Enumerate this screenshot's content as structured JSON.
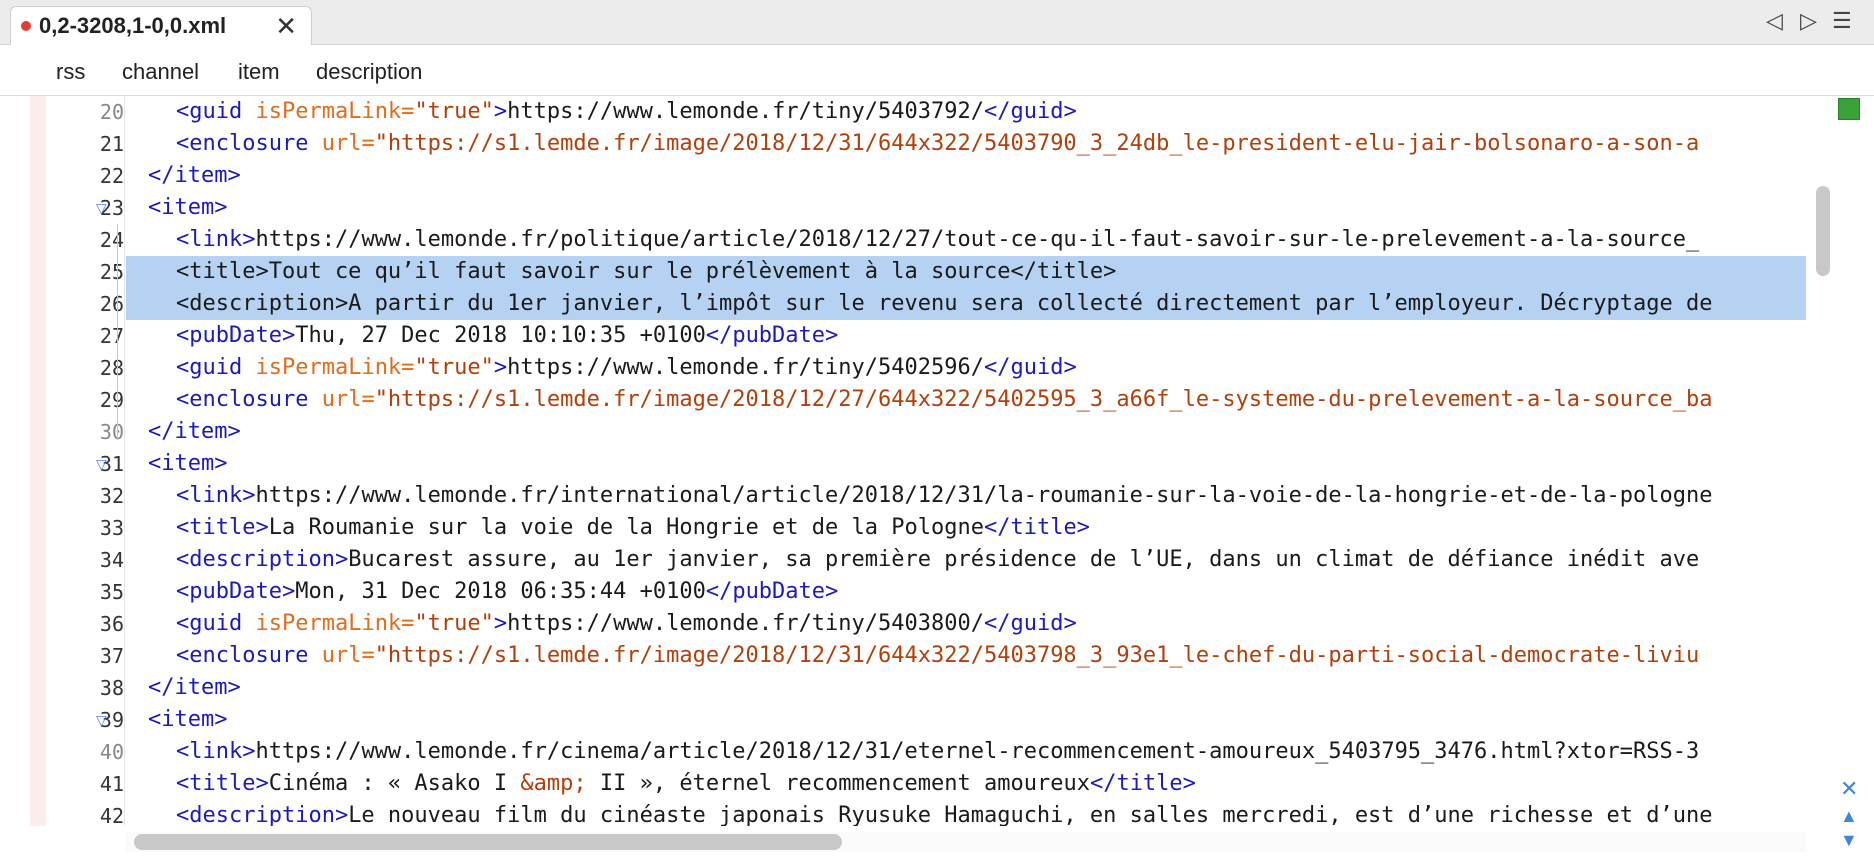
{
  "tab": {
    "title": "0,2-3208,1-0,0.xml",
    "close_icon": "✕",
    "prev_icon": "◁",
    "next_icon": "▷",
    "menu_icon": "☰"
  },
  "breadcrumb": [
    "rss",
    "channel",
    "item",
    "description"
  ],
  "colors": {
    "tag": "#1b1bb5",
    "attr": "#e06c1d",
    "value": "#b13f0a",
    "selection": "#b6d2f3",
    "ok": "#39a33a"
  },
  "lines": [
    {
      "num": "20",
      "segments": [
        {
          "c": "t",
          "s": "<guid "
        },
        {
          "c": "a",
          "s": "isPermaLink="
        },
        {
          "c": "v",
          "s": "\"true\""
        },
        {
          "c": "t",
          "s": ">"
        },
        {
          "c": "",
          "s": "https://www.lemonde.fr/tiny/5403792/"
        },
        {
          "c": "t",
          "s": "</guid>"
        }
      ]
    },
    {
      "num": "21",
      "segments": [
        {
          "c": "t",
          "s": "<enclosure "
        },
        {
          "c": "a",
          "s": "url="
        },
        {
          "c": "v",
          "s": "\"https://s1.lemde.fr/image/2018/12/31/644x322/5403790_3_24db_le-president-elu-jair-bolsonaro-a-son-a"
        }
      ]
    },
    {
      "num": "22",
      "segments": [
        {
          "c": "t",
          "s": "</item>"
        }
      ]
    },
    {
      "num": "23",
      "segments": [
        {
          "c": "t",
          "s": "<item>"
        }
      ]
    },
    {
      "num": "24",
      "segments": [
        {
          "c": "t",
          "s": "<link>"
        },
        {
          "c": "",
          "s": "https://www.lemonde.fr/politique/article/2018/12/27/tout-ce-qu-il-faut-savoir-sur-le-prelevement-a-la-source_"
        }
      ]
    },
    {
      "num": "25",
      "segments": [
        {
          "c": "",
          "s": "<title>Tout ce qu’il faut savoir sur le prélèvement à la source</title>"
        }
      ]
    },
    {
      "num": "26",
      "segments": [
        {
          "c": "",
          "s": "<description>A partir du 1er janvier, l’impôt sur le revenu sera collecté directement par l’employeur. Décryptage de"
        }
      ]
    },
    {
      "num": "27",
      "segments": [
        {
          "c": "t",
          "s": "<pubDate>"
        },
        {
          "c": "",
          "s": "Thu, 27 Dec 2018 10:10:35 +0100"
        },
        {
          "c": "t",
          "s": "</pubDate>"
        }
      ]
    },
    {
      "num": "28",
      "segments": [
        {
          "c": "t",
          "s": "<guid "
        },
        {
          "c": "a",
          "s": "isPermaLink="
        },
        {
          "c": "v",
          "s": "\"true\""
        },
        {
          "c": "t",
          "s": ">"
        },
        {
          "c": "",
          "s": "https://www.lemonde.fr/tiny/5402596/"
        },
        {
          "c": "t",
          "s": "</guid>"
        }
      ]
    },
    {
      "num": "29",
      "segments": [
        {
          "c": "t",
          "s": "<enclosure "
        },
        {
          "c": "a",
          "s": "url="
        },
        {
          "c": "v",
          "s": "\"https://s1.lemde.fr/image/2018/12/27/644x322/5402595_3_a66f_le-systeme-du-prelevement-a-la-source_ba"
        }
      ]
    },
    {
      "num": "30",
      "segments": [
        {
          "c": "t",
          "s": "</item>"
        }
      ]
    },
    {
      "num": "31",
      "segments": [
        {
          "c": "t",
          "s": "<item>"
        }
      ]
    },
    {
      "num": "32",
      "segments": [
        {
          "c": "t",
          "s": "<link>"
        },
        {
          "c": "",
          "s": "https://www.lemonde.fr/international/article/2018/12/31/la-roumanie-sur-la-voie-de-la-hongrie-et-de-la-pologne"
        }
      ]
    },
    {
      "num": "33",
      "segments": [
        {
          "c": "t",
          "s": "<title>"
        },
        {
          "c": "",
          "s": "La Roumanie sur la voie de la Hongrie et de la Pologne"
        },
        {
          "c": "t",
          "s": "</title>"
        }
      ]
    },
    {
      "num": "34",
      "segments": [
        {
          "c": "t",
          "s": "<description>"
        },
        {
          "c": "",
          "s": "Bucarest assure, au 1er janvier, sa première présidence de l’UE, dans un climat de défiance inédit ave"
        }
      ]
    },
    {
      "num": "35",
      "segments": [
        {
          "c": "t",
          "s": "<pubDate>"
        },
        {
          "c": "",
          "s": "Mon, 31 Dec 2018 06:35:44 +0100"
        },
        {
          "c": "t",
          "s": "</pubDate>"
        }
      ]
    },
    {
      "num": "36",
      "segments": [
        {
          "c": "t",
          "s": "<guid "
        },
        {
          "c": "a",
          "s": "isPermaLink="
        },
        {
          "c": "v",
          "s": "\"true\""
        },
        {
          "c": "t",
          "s": ">"
        },
        {
          "c": "",
          "s": "https://www.lemonde.fr/tiny/5403800/"
        },
        {
          "c": "t",
          "s": "</guid>"
        }
      ]
    },
    {
      "num": "37",
      "segments": [
        {
          "c": "t",
          "s": "<enclosure "
        },
        {
          "c": "a",
          "s": "url="
        },
        {
          "c": "v",
          "s": "\"https://s1.lemde.fr/image/2018/12/31/644x322/5403798_3_93e1_le-chef-du-parti-social-democrate-liviu"
        }
      ]
    },
    {
      "num": "38",
      "segments": [
        {
          "c": "t",
          "s": "</item>"
        }
      ]
    },
    {
      "num": "39",
      "segments": [
        {
          "c": "t",
          "s": "<item>"
        }
      ]
    },
    {
      "num": "40",
      "segments": [
        {
          "c": "t",
          "s": "<link>"
        },
        {
          "c": "",
          "s": "https://www.lemonde.fr/cinema/article/2018/12/31/eternel-recommencement-amoureux_5403795_3476.html?xtor=RSS-3"
        }
      ]
    },
    {
      "num": "41",
      "segments": [
        {
          "c": "t",
          "s": "<title>"
        },
        {
          "c": "",
          "s": "Cinéma : « Asako I "
        },
        {
          "c": "v",
          "s": "&amp;"
        },
        {
          "c": "",
          "s": " II », éternel recommencement amoureux"
        },
        {
          "c": "t",
          "s": "</title>"
        }
      ]
    },
    {
      "num": "42",
      "segments": [
        {
          "c": "t",
          "s": "<description>"
        },
        {
          "c": "",
          "s": "Le nouveau film du cinéaste japonais Ryusuke Hamaguchi, en salles mercredi, est d’une richesse et d’une"
        }
      ]
    }
  ]
}
